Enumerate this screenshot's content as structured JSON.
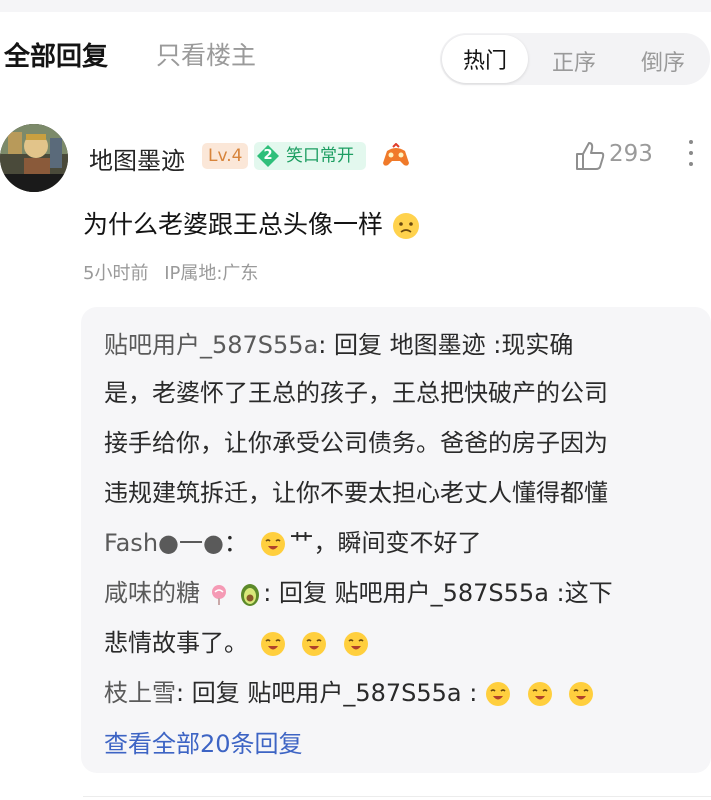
{
  "header": {
    "tab_all": "全部回复",
    "tab_op_only": "只看楼主",
    "sort": {
      "hot": "热门",
      "asc": "正序",
      "desc": "倒序",
      "selected": "热门"
    }
  },
  "post": {
    "username": "地图墨迹",
    "level": "Lv.4",
    "title_badge": {
      "level": "2",
      "text": "笑口常开"
    },
    "like_count": "293",
    "content": "为什么老婆跟王总头像一样",
    "time": "5小时前",
    "ip": "IP属地:广东"
  },
  "replies": {
    "r1_user": "贴吧用户_587S55a",
    "r1_lines": [
      ": 回复 地图墨迹 :现实确",
      "是，老婆怀了王总的孩子，王总把快破产的公司",
      "接手给你，让你承受公司债务。爸爸的房子因为",
      "违规建筑拆迁，让你不要太担心老丈人懂得都懂"
    ],
    "r2_user": "Fash●一●",
    "r2_text": "艹，瞬间变不好了",
    "r3_user": "咸味的糖",
    "r3_line1": ": 回复 贴吧用户_587S55a :这下",
    "r3_line2": "悲情故事了。",
    "r4_user": "枝上雪",
    "r4_text": ": 回复 贴吧用户_587S55a :",
    "view_all": "查看全部20条回复"
  },
  "colors": {
    "accent_link": "#3d64c4",
    "level_badge": "#d7843b",
    "title_badge": "#1d9e62"
  }
}
